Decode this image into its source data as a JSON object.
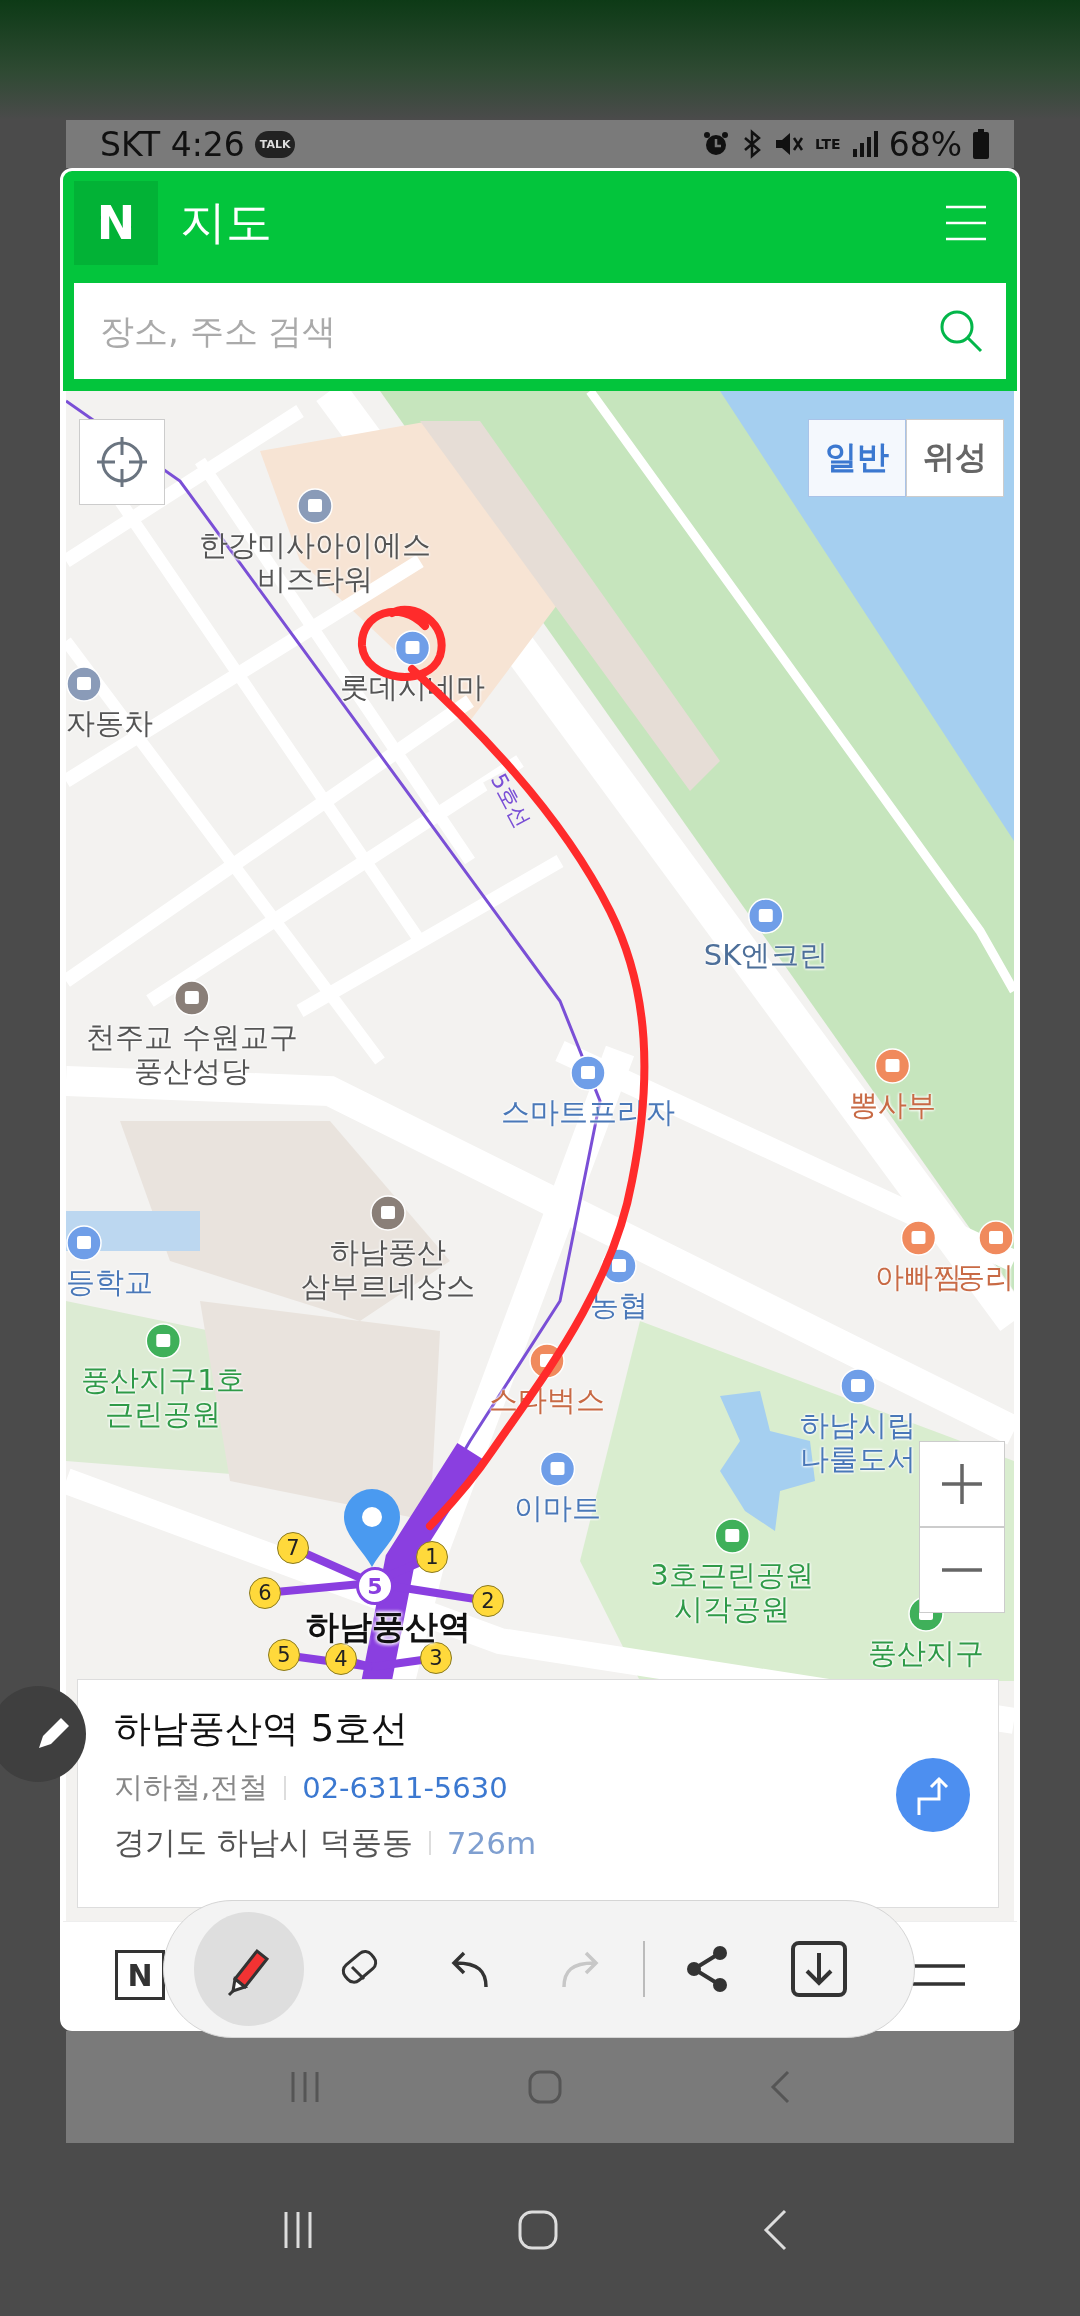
{
  "status_bar": {
    "carrier_time": "SKT 4:26",
    "notification": "TALK",
    "network": "LTE",
    "battery": "68%"
  },
  "header": {
    "logo": "N",
    "title": "지도",
    "search": {
      "placeholder": "장소, 주소 검색"
    }
  },
  "map": {
    "view_toggle": [
      {
        "label": "일반",
        "selected": true
      },
      {
        "label": "위성",
        "selected": false
      }
    ],
    "line_label": "5호선",
    "places": [
      {
        "kind": "office",
        "lines": [
          "한강미사아이에스",
          "비즈타워"
        ]
      },
      {
        "kind": "cinema",
        "lines": [
          "롯데시네마"
        ]
      },
      {
        "kind": "transit",
        "lines": [
          "자동차"
        ]
      },
      {
        "kind": "fuel",
        "lines": [
          "SK엔크린"
        ]
      },
      {
        "kind": "church",
        "lines": [
          "천주교 수원교구",
          "풍산성당"
        ]
      },
      {
        "kind": "shop",
        "lines": [
          "스마트프라자"
        ]
      },
      {
        "kind": "food",
        "lines": [
          "뽕사부"
        ]
      },
      {
        "kind": "school",
        "lines": [
          "등학교"
        ]
      },
      {
        "kind": "apartment",
        "lines": [
          "하남풍산",
          "삼부르네상스"
        ]
      },
      {
        "kind": "bank",
        "lines": [
          "농협"
        ]
      },
      {
        "kind": "food",
        "lines": [
          "아빠찜"
        ]
      },
      {
        "kind": "food",
        "lines": [
          "동리"
        ]
      },
      {
        "kind": "park",
        "lines": [
          "풍산지구1호",
          "근린공원"
        ]
      },
      {
        "kind": "cafe",
        "lines": [
          "스타벅스"
        ]
      },
      {
        "kind": "library",
        "lines": [
          "하남시립",
          "나룰도서"
        ]
      },
      {
        "kind": "mart",
        "lines": [
          "이마트"
        ]
      },
      {
        "kind": "park",
        "lines": [
          "3호근린공원",
          "시각공원"
        ]
      },
      {
        "kind": "park",
        "lines": [
          "풍산지구"
        ]
      }
    ],
    "station": {
      "name": "하남풍산역",
      "line": "5",
      "exits": [
        "7",
        "1",
        "6",
        "2",
        "5",
        "4",
        "3"
      ]
    }
  },
  "place_card": {
    "title": "하남풍산역 5호선",
    "category": "지하철,전철",
    "phone": "02-6311-5630",
    "address": "경기도 하남시 덕풍동",
    "distance": "726m"
  },
  "bottom_nav": {
    "logo": "N"
  },
  "edit_toolbar": [
    {
      "kind": "pen",
      "selected": true,
      "disabled": false
    },
    {
      "kind": "eraser",
      "selected": false,
      "disabled": false
    },
    {
      "kind": "undo",
      "selected": false,
      "disabled": false
    },
    {
      "kind": "redo",
      "selected": false,
      "disabled": true
    },
    {
      "kind": "share",
      "selected": false,
      "disabled": false
    },
    {
      "kind": "save",
      "selected": false,
      "disabled": false
    }
  ]
}
